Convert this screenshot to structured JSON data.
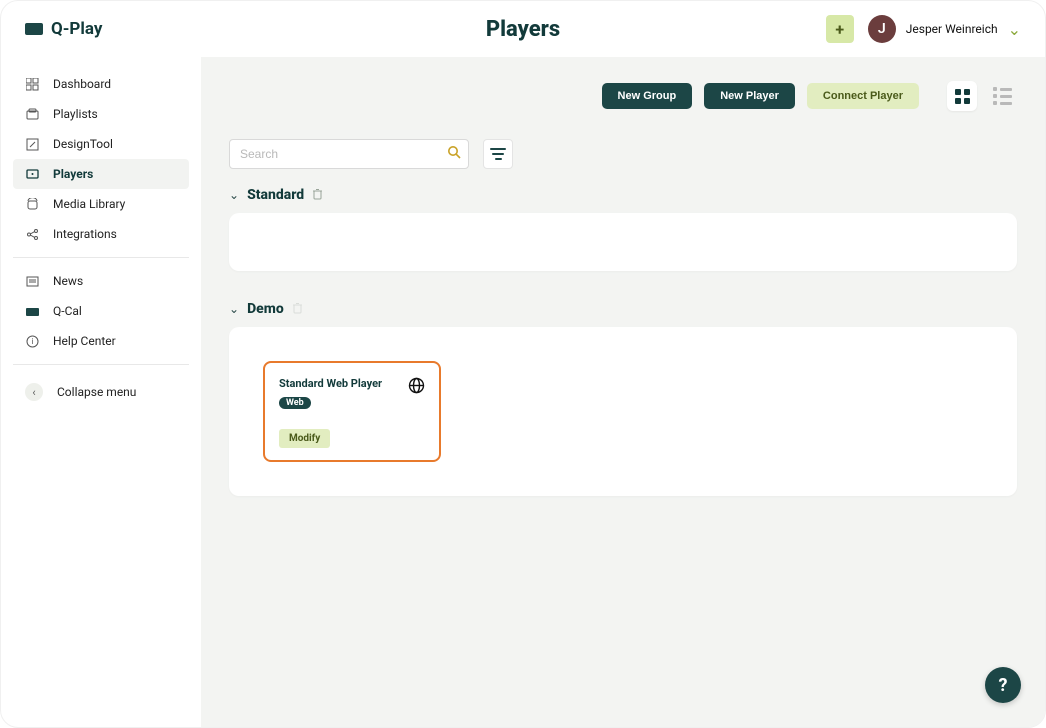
{
  "brand": "Q-Play",
  "page_title": "Players",
  "header": {
    "plus_label": "+",
    "avatar_initial": "J",
    "user_name": "Jesper Weinreich"
  },
  "sidebar": {
    "items": [
      {
        "label": "Dashboard",
        "icon": "dashboard-icon"
      },
      {
        "label": "Playlists",
        "icon": "playlists-icon"
      },
      {
        "label": "DesignTool",
        "icon": "designtool-icon"
      },
      {
        "label": "Players",
        "icon": "players-icon"
      },
      {
        "label": "Media Library",
        "icon": "media-library-icon"
      },
      {
        "label": "Integrations",
        "icon": "integrations-icon"
      }
    ],
    "secondary": [
      {
        "label": "News",
        "icon": "news-icon"
      },
      {
        "label": "Q-Cal",
        "icon": "qcal-icon"
      },
      {
        "label": "Help Center",
        "icon": "help-center-icon"
      }
    ],
    "collapse_label": "Collapse menu"
  },
  "toolbar": {
    "new_group": "New Group",
    "new_player": "New Player",
    "connect_player": "Connect Player"
  },
  "search": {
    "placeholder": "Search"
  },
  "groups": [
    {
      "name": "Standard",
      "players": []
    },
    {
      "name": "Demo",
      "players": [
        {
          "name": "Standard Web Player",
          "tag": "Web",
          "modify_label": "Modify"
        }
      ]
    }
  ],
  "help_fab": "?"
}
